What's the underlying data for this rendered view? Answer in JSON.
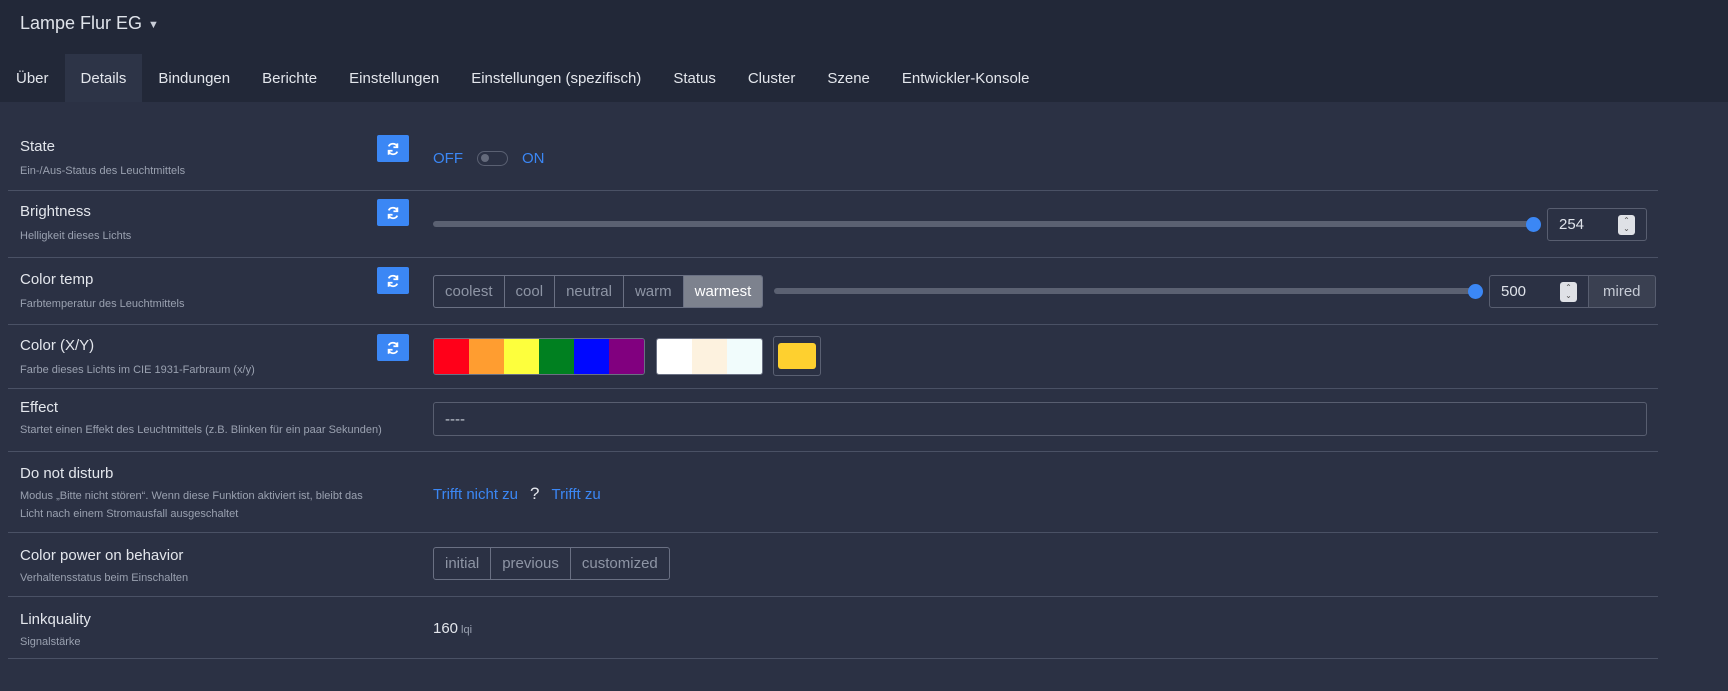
{
  "device": {
    "title": "Lampe Flur EG",
    "dropdown_icon": "chevron-down-icon"
  },
  "tabs": [
    {
      "label": "Über"
    },
    {
      "label": "Details"
    },
    {
      "label": "Bindungen"
    },
    {
      "label": "Berichte"
    },
    {
      "label": "Einstellungen"
    },
    {
      "label": "Einstellungen (spezifisch)"
    },
    {
      "label": "Status"
    },
    {
      "label": "Cluster"
    },
    {
      "label": "Szene"
    },
    {
      "label": "Entwickler-Konsole"
    }
  ],
  "active_tab": "Details",
  "colors": {
    "accent": "#3b87f5",
    "background": "#2b3144",
    "header": "#222838"
  },
  "rows": {
    "state": {
      "name": "State",
      "desc": "Ein-/Aus-Status des Leuchtmittels",
      "off_label": "OFF",
      "on_label": "ON",
      "value": "off"
    },
    "brightness": {
      "name": "Brightness",
      "desc": "Helligkeit dieses Lichts",
      "value": "254",
      "slider_fraction": 1.0
    },
    "color_temp": {
      "name": "Color temp",
      "desc": "Farbtemperatur des Leuchtmittels",
      "presets": [
        "coolest",
        "cool",
        "neutral",
        "warm",
        "warmest"
      ],
      "selected": "warmest",
      "value": "500",
      "unit": "mired",
      "slider_fraction": 1.0
    },
    "color_xy": {
      "name": "Color (X/Y)",
      "desc": "Farbe dieses Lichts im CIE 1931-Farbraum (x/y)",
      "palette": [
        "#ff0019",
        "#ff9d30",
        "#fdff3d",
        "#008020",
        "#0008ff",
        "#81007f"
      ],
      "whites": [
        "#ffffff",
        "#fdf2df",
        "#f1fcfc"
      ],
      "current": "#fed02f"
    },
    "effect": {
      "name": "Effect",
      "desc": "Startet einen Effekt des Leuchtmittels (z.B. Blinken für ein paar Sekunden)",
      "value": "----"
    },
    "dnd": {
      "name": "Do not disturb",
      "desc1": "Modus „Bitte nicht stören“. Wenn diese Funktion aktiviert ist, bleibt das",
      "desc2": "Licht nach einem Stromausfall ausgeschaltet",
      "false_label": "Trifft nicht zu",
      "unknown": "?",
      "true_label": "Trifft zu"
    },
    "power_on": {
      "name": "Color power on behavior",
      "desc": "Verhaltensstatus beim Einschalten",
      "options": [
        "initial",
        "previous",
        "customized"
      ]
    },
    "linkquality": {
      "name": "Linkquality",
      "desc": "Signalstärke",
      "value": "160",
      "unit": "lqi"
    }
  }
}
